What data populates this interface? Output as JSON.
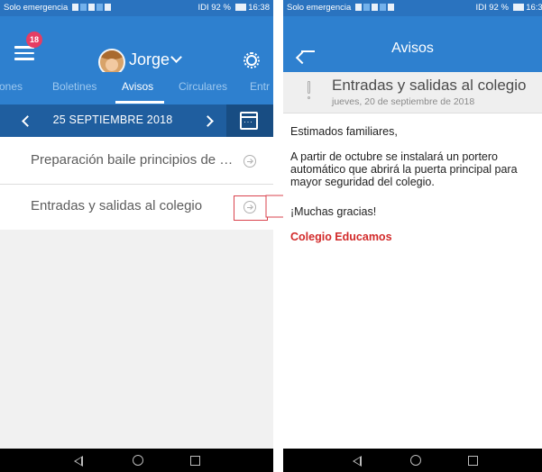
{
  "status_bar": {
    "carrier": "Solo emergencia",
    "right": "IDI 92 %",
    "time": "16:38"
  },
  "left_screen": {
    "header": {
      "badge_count": "18",
      "user_name": "Jorge"
    },
    "tabs": [
      {
        "label": "ones"
      },
      {
        "label": "Boletines"
      },
      {
        "label": "Avisos",
        "active": true
      },
      {
        "label": "Circulares"
      },
      {
        "label": "Entr"
      }
    ],
    "date_nav": {
      "date": "25 SEPTIEMBRE 2018"
    },
    "items": [
      {
        "title": "Preparación baile principios de octubre"
      },
      {
        "title": "Entradas y salidas al colegio"
      }
    ]
  },
  "right_screen": {
    "header": {
      "title": "Avisos"
    },
    "notice": {
      "title": "Entradas y salidas al colegio",
      "date": "jueves, 20 de septiembre de 2018",
      "greeting": "Estimados familiares,",
      "body": "A partir de octubre se instalará un portero automático que abrirá la puerta principal para mayor seguridad del colegio.",
      "thanks": "¡Muchas gracias!",
      "signature": "Colegio Educamos"
    }
  },
  "colors": {
    "primary": "#2e80cf",
    "primary_dark": "#1f5e9f",
    "accent_red": "#d22a2a",
    "badge": "#e53d63"
  },
  "icons": [
    "menu-icon",
    "settings-icon",
    "calendar-icon",
    "arrow-circle-right-icon",
    "back-arrow-icon",
    "exclamation-icon"
  ]
}
